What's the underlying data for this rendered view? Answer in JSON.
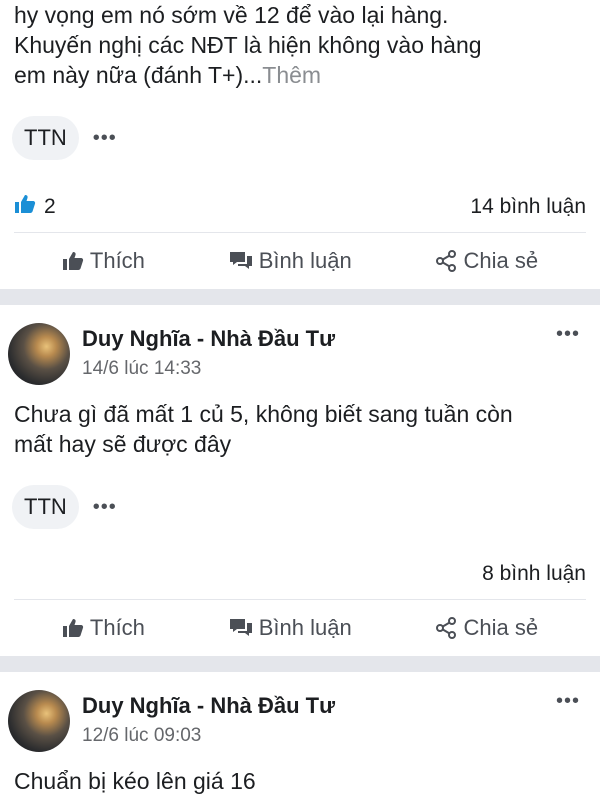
{
  "post1": {
    "text_lines": [
      "hy vọng em nó sớm về 12 để vào lại hàng.",
      "Khuyến nghị các NĐT là hiện không vào hàng",
      "em này nữa (đánh T+)..."
    ],
    "more_label": "Thêm",
    "tag": "TTN",
    "tag_more": "•••",
    "like_count": "2",
    "comments": "14 bình luận"
  },
  "post2": {
    "author": "Duy Nghĩa - Nhà Đầu Tư",
    "time": "14/6 lúc 14:33",
    "text_lines": [
      "Chưa gì đã mất 1 củ 5, không biết sang tuần còn",
      "mất hay sẽ được đây"
    ],
    "tag": "TTN",
    "tag_more": "•••",
    "comments": "8 bình luận",
    "menu": "•••"
  },
  "post3": {
    "author": "Duy Nghĩa - Nhà Đầu Tư",
    "time": "12/6 lúc 09:03",
    "text": "Chuẩn bị kéo lên giá 16",
    "menu": "•••"
  },
  "actions": {
    "like": "Thích",
    "comment": "Bình luận",
    "share": "Chia sẻ"
  },
  "colors": {
    "like_icon": "#1b8fd6",
    "separator": "#e4e6eb",
    "muted": "#65676b"
  },
  "icons": [
    "thumbs-up-icon",
    "comment-icon",
    "share-icon",
    "more-dots-icon"
  ]
}
